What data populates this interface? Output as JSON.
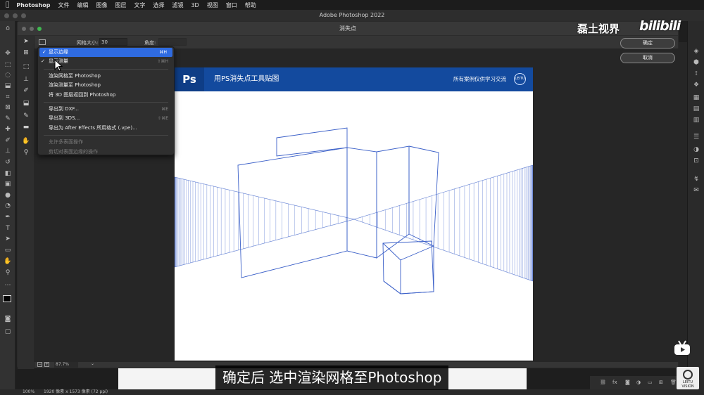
{
  "menubar": {
    "apple": "",
    "app": "Photoshop",
    "items": [
      "文件",
      "编辑",
      "图像",
      "图层",
      "文字",
      "选择",
      "滤镜",
      "3D",
      "视图",
      "窗口",
      "帮助"
    ]
  },
  "ps_window_title": "Adobe Photoshop 2022",
  "dialog": {
    "title": "消失点",
    "grid_size_label": "网格大小:",
    "grid_size_value": "30",
    "angle_label": "角度:",
    "ok_label": "确定",
    "cancel_label": "取消",
    "zoom_value": "87.7%"
  },
  "menu": {
    "items": [
      {
        "label": "显示边缘",
        "shortcut": "⌘H",
        "checked": true,
        "selected": true
      },
      {
        "label": "显示测量",
        "shortcut": "⇧⌘H",
        "checked": true
      },
      {
        "label": "渲染网格至 Photoshop"
      },
      {
        "label": "渲染测量至 Photoshop"
      },
      {
        "label": "将 3D 图层返回到 Photoshop"
      },
      {
        "label": "导出到 DXF...",
        "shortcut": "⌘E"
      },
      {
        "label": "导出到 3DS...",
        "shortcut": "⇧⌘E"
      },
      {
        "label": "导出为 After Effects 所用格式 (.vpe)..."
      },
      {
        "label": "允许多表面操作",
        "disabled": true
      },
      {
        "label": "剪切对表面边缘的操作",
        "disabled": true
      }
    ]
  },
  "document": {
    "logo": "Ps",
    "banner_title": "用PS消失点工具贴图",
    "banner_right": "所有案例仅供学习交流",
    "banner_brand": "LEITU",
    "grid_color": "#3a5fc8",
    "banner_color": "#134a9e"
  },
  "watermark": {
    "channel": "磊土视界",
    "site": "bilibili"
  },
  "subtitle": "确定后 选中渲染网格至Photoshop",
  "leitu_badge": {
    "top": "LEITU",
    "bottom": "VISION"
  },
  "status": {
    "zoom": "100%",
    "info": "1920 像素 x 1573 像素 (72 ppi)"
  },
  "colors": {
    "menu_highlight": "#2f6be0",
    "panel_bg": "#353535"
  }
}
